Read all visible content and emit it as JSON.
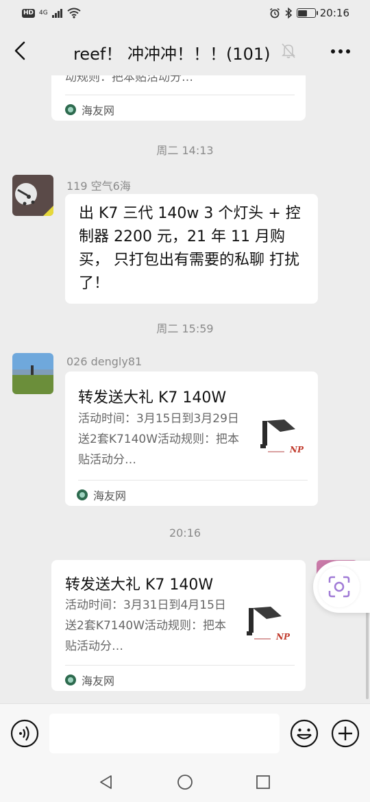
{
  "status_bar": {
    "hd_badge": "HD",
    "network": "4G",
    "time": "20:16"
  },
  "header": {
    "title": "reef！ 冲冲冲！！！(101)"
  },
  "chat": {
    "messages": [
      {
        "type": "card",
        "desc": "动规则：把本贴活动分…",
        "source": "海友网"
      },
      {
        "type": "time",
        "text": "周二 14:13"
      },
      {
        "type": "text",
        "sender": "119 空气6海",
        "text": "出 K7 三代 140w 3 个灯头 + 控制器 2200 元，21 年 11 月购买， 只打包出有需要的私聊 打扰了！"
      },
      {
        "type": "time",
        "text": "周二 15:59"
      },
      {
        "type": "card",
        "sender": "026 dengly81",
        "title": "转发送大礼  K7 140W",
        "desc": "活动时间：3月15日到3月29日送2套K7140W活动规则：把本贴活动分…",
        "source": "海友网"
      },
      {
        "type": "time",
        "text": "20:16"
      },
      {
        "type": "card",
        "title": "转发送大礼 K7 140W",
        "desc": "活动时间：3月31日到4月15日送2套K7140W活动规则：把本贴活动分…",
        "source": "海友网"
      }
    ]
  },
  "input_bar": {
    "placeholder": ""
  },
  "icons": {
    "back": "chevron-left-icon",
    "mute": "bell-off-icon",
    "more": "more-icon",
    "voice": "voice-icon",
    "emoji": "emoji-icon",
    "plus": "plus-icon",
    "scan": "scan-icon"
  },
  "colors": {
    "background": "#ededed",
    "bubble": "#ffffff",
    "time_text": "#8a8a8a",
    "scan_accent": "#a07ad6"
  }
}
